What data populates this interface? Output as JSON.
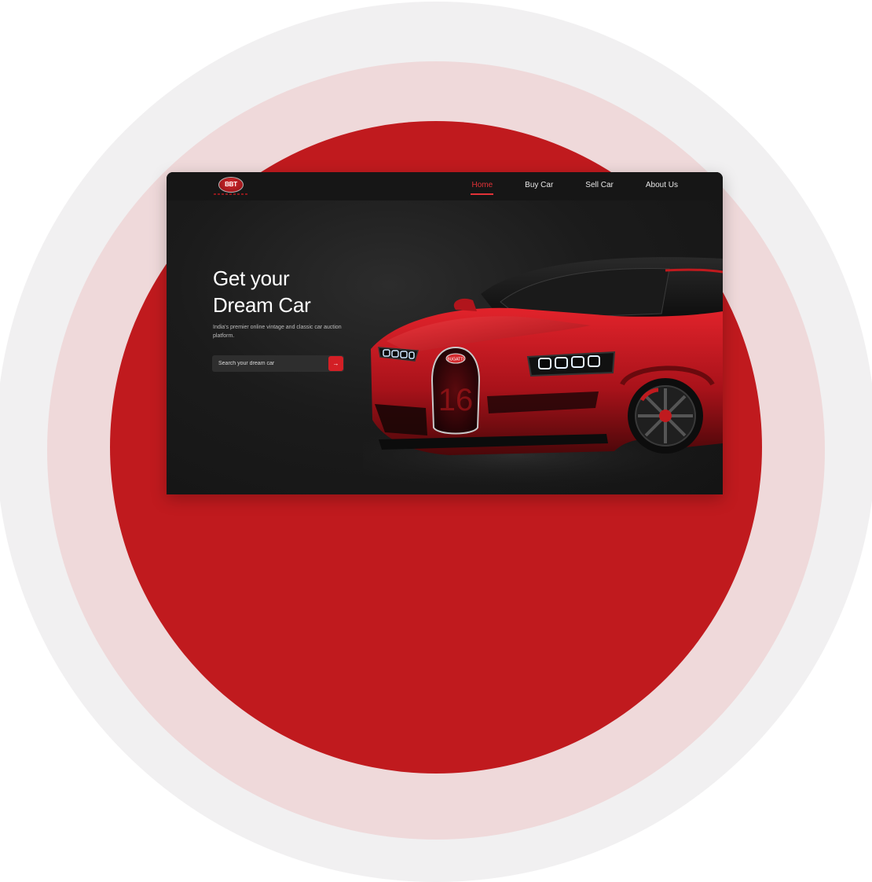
{
  "logo": {
    "text": "BBT",
    "icon": "brand-logo-icon"
  },
  "nav": {
    "items": [
      {
        "label": "Home",
        "active": true
      },
      {
        "label": "Buy Car",
        "active": false
      },
      {
        "label": "Sell Car",
        "active": false
      },
      {
        "label": "About Us",
        "active": false
      }
    ]
  },
  "hero": {
    "title_line1": "Get your",
    "title_line2": "Dream Car",
    "subtitle": "India's premier online vintage and classic car auction platform."
  },
  "search": {
    "placeholder": "Search your dream car",
    "button_icon": "arrow-right-icon",
    "button_glyph": "→"
  },
  "car": {
    "badge_number": "16",
    "badge_text": "BUGATTI"
  },
  "colors": {
    "accent": "#e23237",
    "brand_red": "#c01a1e",
    "dark_bg": "#161616"
  }
}
